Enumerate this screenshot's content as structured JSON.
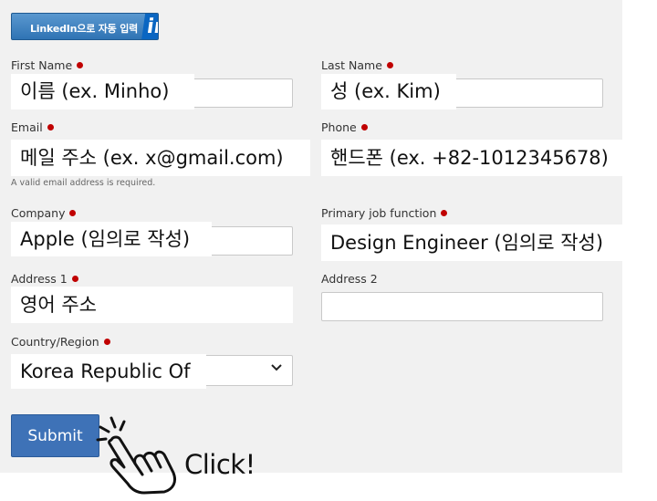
{
  "linkedin_button": {
    "label": "LinkedIn으로 자동 입력",
    "icon": "linkedin-icon",
    "logo_text": "in"
  },
  "fields": {
    "first_name": {
      "label": "First Name",
      "value": "이름 (ex. Minho)"
    },
    "last_name": {
      "label": "Last Name",
      "value": "성 (ex. Kim)"
    },
    "email": {
      "label": "Email",
      "value": "메일 주소 (ex. x@gmail.com)",
      "hint": "A valid email address is required."
    },
    "phone": {
      "label": "Phone",
      "value": "핸드폰 (ex. +82-1012345678)"
    },
    "company": {
      "label": "Company",
      "value": "Apple (임의로 작성)"
    },
    "job_function": {
      "label": "Primary job function",
      "value": "Design Engineer (임의로 작성)"
    },
    "address1": {
      "label": "Address 1",
      "value": "영어 주소"
    },
    "address2": {
      "label": "Address 2",
      "value": ""
    },
    "country": {
      "label": "Country/Region",
      "value": "Korea Republic Of"
    }
  },
  "submit": {
    "label": "Submit"
  },
  "annotation": {
    "text": "Click!",
    "icon": "pointing-hand-icon"
  },
  "colors": {
    "required_dot": "#c00000",
    "submit_bg": "#3e72b7",
    "panel_bg": "#f1f1f1"
  }
}
